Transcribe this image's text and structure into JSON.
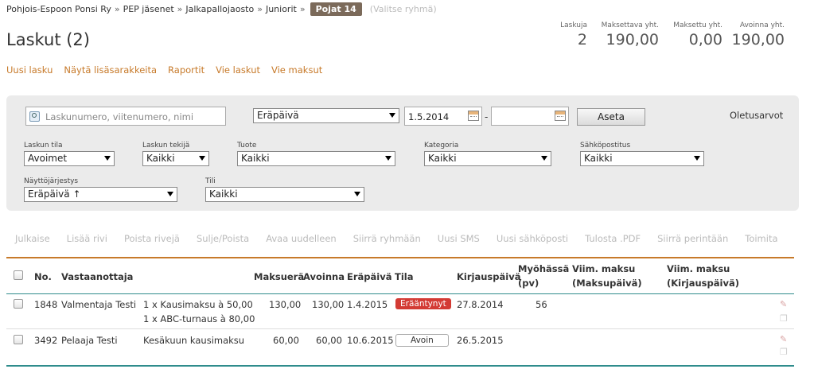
{
  "breadcrumb": {
    "items": [
      "Pohjois-Espoon Ponsi Ry",
      "PEP jäsenet",
      "Jalkapallojaosto",
      "Juniorit"
    ],
    "separator": "»",
    "current": "Pojat 14",
    "group_hint": "(Valitse ryhmä)"
  },
  "page": {
    "title": "Laskut (2)"
  },
  "summary": {
    "count_label": "Laskuja",
    "count_value": "2",
    "payable_label": "Maksettava yht.",
    "payable_value": "190,00",
    "paid_label": "Maksettu yht.",
    "paid_value": "0,00",
    "open_label": "Avoinna yht.",
    "open_value": "190,00"
  },
  "actions": [
    "Uusi lasku",
    "Näytä lisäsarakkeita",
    "Raportit",
    "Vie laskut",
    "Vie maksut"
  ],
  "filters": {
    "search_placeholder": "Laskunumero, viitenumero, nimi",
    "date_type": "Eräpäivä",
    "date_from": "1.5.2014",
    "date_to": "",
    "date_separator": "-",
    "set_label": "Aseta",
    "defaults_label": "Oletusarvot",
    "status_label": "Laskun tila",
    "status_value": "Avoimet",
    "creator_label": "Laskun tekijä",
    "creator_value": "Kaikki",
    "product_label": "Tuote",
    "product_value": "Kaikki",
    "category_label": "Kategoria",
    "category_value": "Kaikki",
    "email_label": "Sähköpostitus",
    "email_value": "Kaikki",
    "order_label": "Näyttöjärjestys",
    "order_value": "Eräpäivä ↑",
    "account_label": "Tili",
    "account_value": "Kaikki"
  },
  "toolbar": [
    "Julkaise",
    "Lisää rivi",
    "Poista rivejä",
    "Sulje/Poista",
    "Avaa uudelleen",
    "Siirrä ryhmään",
    "Uusi SMS",
    "Uusi sähköposti",
    "Tulosta .PDF",
    "Siirrä perintään",
    "Toimita"
  ],
  "table": {
    "headers": {
      "no": "No.",
      "recipient": "Vastaanottaja",
      "installment": "Maksuerä",
      "open": "Avoinna",
      "due": "Eräpäivä",
      "status": "Tila",
      "entry_date": "Kirjauspäivä",
      "late_1": "Myöhässä",
      "late_2": "(pv)",
      "last_pay_1": "Viim. maksu",
      "last_pay_2": "(Maksupäivä)",
      "last_entry_1": "Viim. maksu",
      "last_entry_2": "(Kirjauspäivä)"
    },
    "rows": [
      {
        "no": "1848",
        "recipient": "Valmentaja Testi",
        "item_1": "1 x Kausimaksu à 50,00",
        "item_2": "1 x ABC-turnaus à 80,00",
        "installment": "130,00",
        "open": "130,00",
        "due": "1.4.2015",
        "status": "Erääntynyt",
        "entry_date": "27.8.2014",
        "late": "56"
      },
      {
        "no": "3492",
        "recipient": "Pelaaja Testi",
        "item_1": "Kesäkuun kausimaksu",
        "installment": "60,00",
        "open": "60,00",
        "due": "10.6.2015",
        "status": "Avoin",
        "entry_date": "26.5.2015",
        "late": ""
      }
    ]
  },
  "colors": {
    "accent": "#c77a2a",
    "current_crumb": "#7b6a5a",
    "overdue": "#d33b34",
    "table_bottom": "#2f8c8c"
  }
}
